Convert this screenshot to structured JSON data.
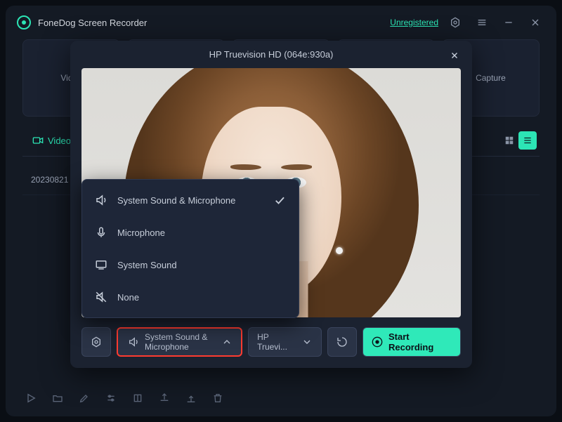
{
  "app": {
    "title": "FoneDog Screen Recorder",
    "unregistered": "Unregistered"
  },
  "modes": {
    "video": "Video",
    "capture": "Capture"
  },
  "tabs": {
    "video": "Video"
  },
  "files": {
    "name": "20230821"
  },
  "modal": {
    "device_title": "HP Truevision HD (064e:930a)",
    "audio_label": "System Sound & Microphone",
    "camera_label": "HP Truevi...",
    "start_label": "Start Recording"
  },
  "audio_menu": {
    "opt1": "System Sound & Microphone",
    "opt2": "Microphone",
    "opt3": "System Sound",
    "opt4": "None"
  }
}
